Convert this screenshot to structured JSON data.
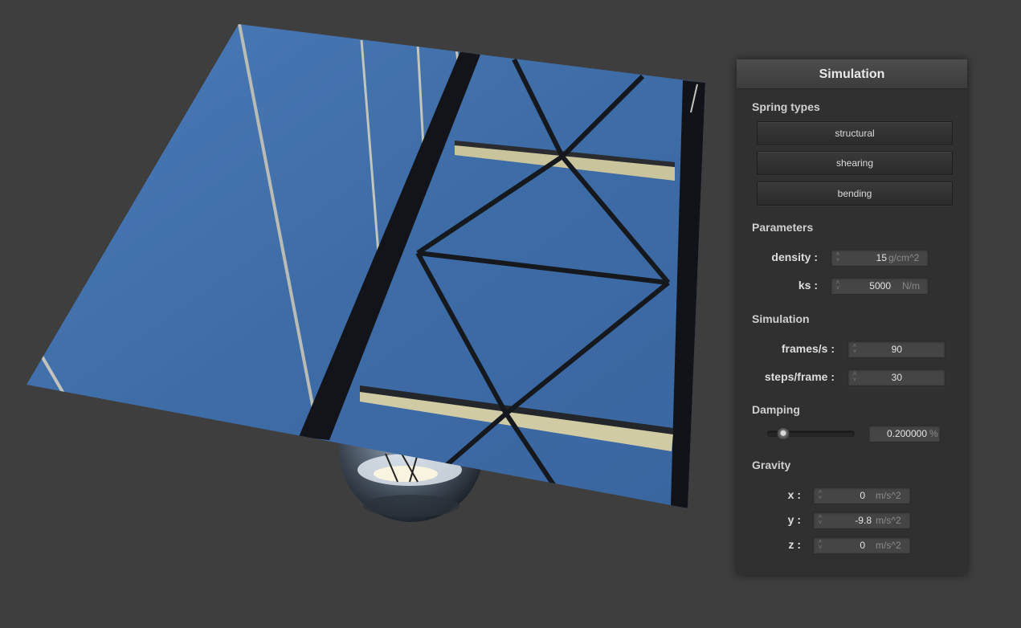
{
  "panel": {
    "title": "Simulation",
    "spring_types": {
      "title": "Spring types",
      "buttons": [
        "structural",
        "shearing",
        "bending"
      ]
    },
    "parameters": {
      "title": "Parameters",
      "fields": [
        {
          "label": "density :",
          "value": "15",
          "unit": "g/cm^2"
        },
        {
          "label": "ks :",
          "value": "5000",
          "unit": "N/m"
        }
      ]
    },
    "simulation": {
      "title": "Simulation",
      "fields": [
        {
          "label": "frames/s :",
          "value": "90",
          "unit": ""
        },
        {
          "label": "steps/frame :",
          "value": "30",
          "unit": ""
        }
      ]
    },
    "damping": {
      "title": "Damping",
      "value": "0.200000",
      "unit": "%",
      "slider_fraction": 0.2
    },
    "gravity": {
      "title": "Gravity",
      "fields": [
        {
          "label": "x :",
          "value": "0",
          "unit": "m/s^2"
        },
        {
          "label": "y :",
          "value": "-9.8",
          "unit": "m/s^2"
        },
        {
          "label": "z :",
          "value": "0",
          "unit": "m/s^2"
        }
      ]
    }
  },
  "colors": {
    "background": "#3e3e3e",
    "panel": "#303030",
    "sky": "#3f6faa",
    "steel": "#16191f"
  },
  "scene": {
    "cloth": "textured-cloth-bridge",
    "sphere": "reflective-sphere"
  }
}
